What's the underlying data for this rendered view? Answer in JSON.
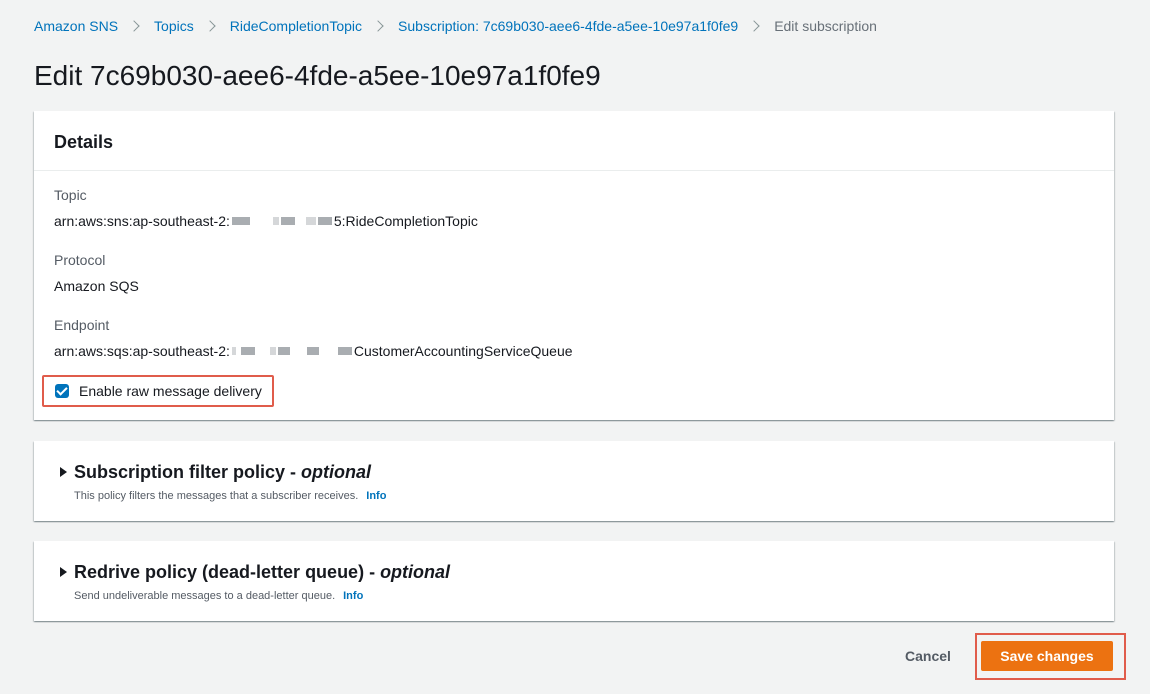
{
  "breadcrumb": {
    "items": [
      "Amazon SNS",
      "Topics",
      "RideCompletionTopic",
      "Subscription: 7c69b030-aee6-4fde-a5ee-10e97a1f0fe9"
    ],
    "current": "Edit subscription"
  },
  "page": {
    "title": "Edit 7c69b030-aee6-4fde-a5ee-10e97a1f0fe9"
  },
  "details": {
    "header": "Details",
    "topic": {
      "label": "Topic",
      "prefix": "arn:aws:sns:ap-southeast-2:",
      "suffix": "5:RideCompletionTopic"
    },
    "protocol": {
      "label": "Protocol",
      "value": "Amazon SQS"
    },
    "endpoint": {
      "label": "Endpoint",
      "prefix": "arn:aws:sqs:ap-southeast-2:",
      "suffix": "CustomerAccountingServiceQueue"
    },
    "raw_delivery": {
      "label": "Enable raw message delivery",
      "checked": true
    }
  },
  "filter_policy": {
    "title": "Subscription filter policy - ",
    "optional": "optional",
    "description": "This policy filters the messages that a subscriber receives.",
    "info": "Info"
  },
  "redrive_policy": {
    "title": "Redrive policy (dead-letter queue) - ",
    "optional": "optional",
    "description": "Send undeliverable messages to a dead-letter queue.",
    "info": "Info"
  },
  "actions": {
    "cancel": "Cancel",
    "save": "Save changes"
  },
  "colors": {
    "link": "#0073bb",
    "primary": "#ec7211",
    "highlight": "#e05c4b",
    "background": "#f2f3f3"
  }
}
